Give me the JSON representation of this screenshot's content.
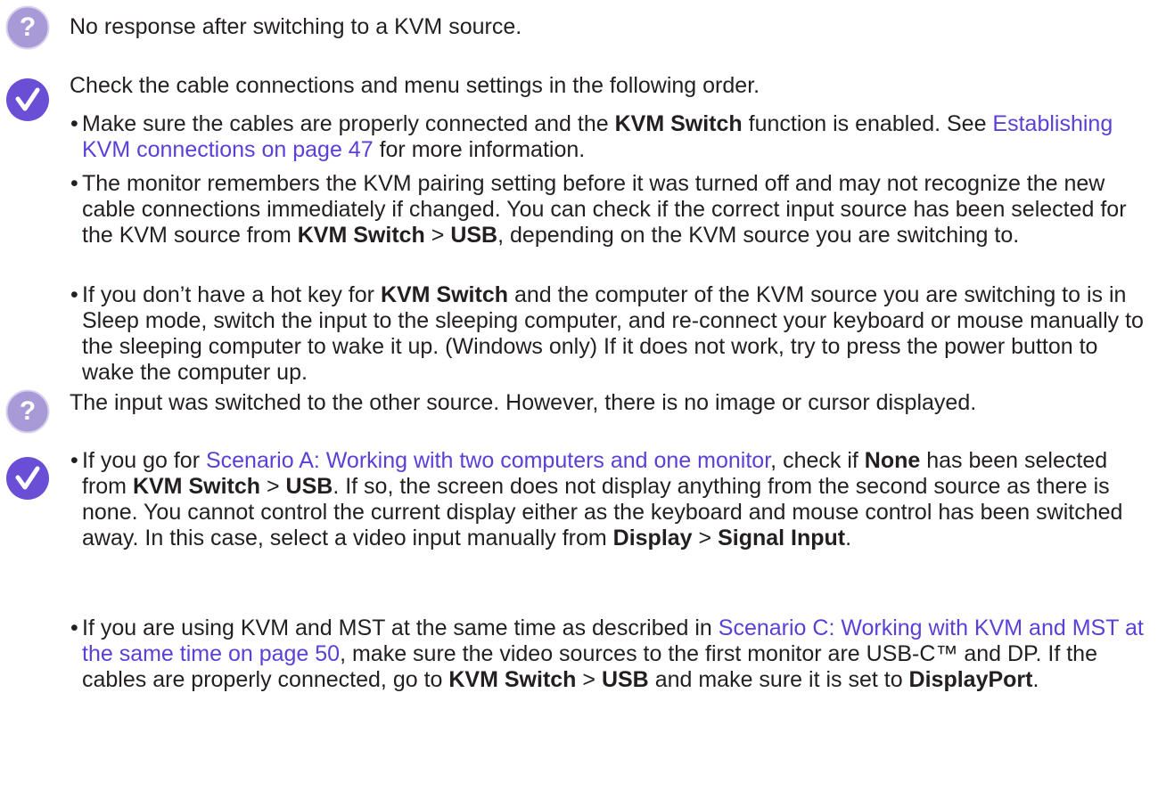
{
  "faq": [
    {
      "question": "No response after switching to a KVM source.",
      "answer_intro": "Check the cable connections and menu settings in the following order.",
      "bullets": [
        {
          "parts": [
            {
              "t": "Make sure the cables are properly connected and the "
            },
            {
              "t": "KVM Switch",
              "b": true
            },
            {
              "t": " function is enabled. See "
            },
            {
              "t": "Establishing KVM connections on page 47",
              "link": true
            },
            {
              "t": " for more information."
            }
          ]
        },
        {
          "parts": [
            {
              "t": "The monitor remembers the KVM pairing setting before it was turned off and may not recognize the new cable connections immediately if changed. You can check if the correct input source has been selected for the KVM source from "
            },
            {
              "t": "KVM Switch",
              "b": true
            },
            {
              "t": " > "
            },
            {
              "t": "USB",
              "b": true
            },
            {
              "t": ", depending on the KVM source you are switching to."
            }
          ]
        },
        {
          "parts": [
            {
              "t": "If you don’t have a hot key for "
            },
            {
              "t": "KVM Switch",
              "b": true
            },
            {
              "t": " and the computer of the KVM source you are switching to is in Sleep mode, switch the input to the sleeping computer, and re-connect your keyboard or mouse manually to the sleeping computer to wake it up. (Windows only) If it does not work, try to press the power button to wake the computer up."
            }
          ]
        }
      ]
    },
    {
      "question": "The input was switched to the other source. However, there is no image or cursor displayed.",
      "answer_intro": "",
      "bullets": [
        {
          "parts": [
            {
              "t": "If you go for "
            },
            {
              "t": "Scenario A: Working with two computers and one monitor",
              "link": true
            },
            {
              "t": ", check if "
            },
            {
              "t": "None",
              "b": true
            },
            {
              "t": " has been selected from "
            },
            {
              "t": "KVM Switch",
              "b": true
            },
            {
              "t": " > "
            },
            {
              "t": "USB",
              "b": true
            },
            {
              "t": ". If so, the screen does not display anything from the second source as there is none. You cannot control the current display either as the keyboard and mouse control has been switched away. In this case, select a video input manually from "
            },
            {
              "t": "Display",
              "b": true
            },
            {
              "t": " > "
            },
            {
              "t": "Signal Input",
              "b": true
            },
            {
              "t": "."
            }
          ]
        },
        {
          "parts": [
            {
              "t": "If you are using KVM and MST at the same time as described in "
            },
            {
              "t": "Scenario C: Working with KVM and MST at the same time on page 50",
              "link": true
            },
            {
              "t": ", make sure the video sources to the first monitor are USB-C™ and DP. If the cables are properly connected, go to "
            },
            {
              "t": "KVM Switch",
              "b": true
            },
            {
              "t": " > "
            },
            {
              "t": "USB",
              "b": true
            },
            {
              "t": " and make sure it is set to "
            },
            {
              "t": "DisplayPort",
              "b": true
            },
            {
              "t": "."
            }
          ]
        }
      ]
    }
  ],
  "icons": {
    "question": "question-mark-icon",
    "answer": "checkmark-icon",
    "question_color": "#9b8fd0",
    "answer_color": "#6a4fd6"
  }
}
